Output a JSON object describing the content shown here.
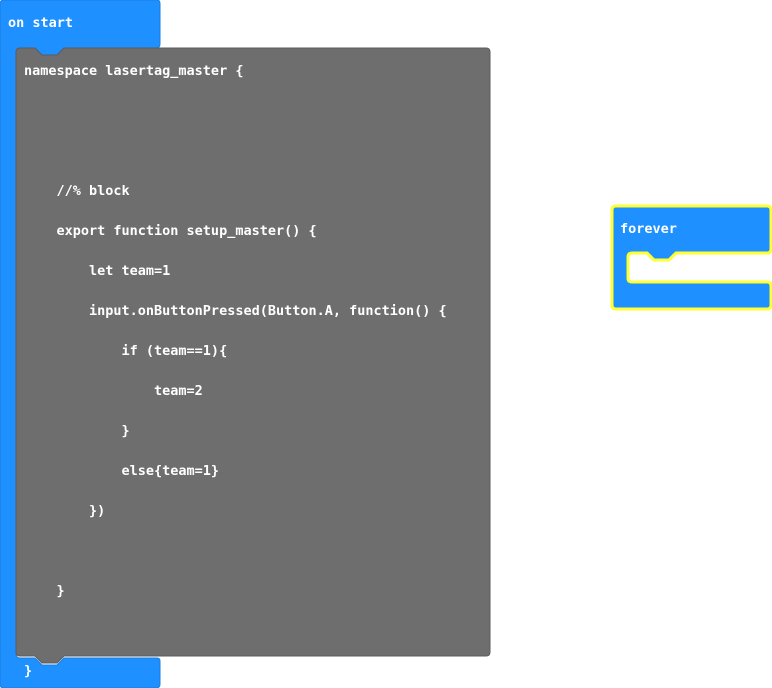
{
  "colors": {
    "event_block": "#1e90ff",
    "event_block_edge": "#1a7fdf",
    "code_block": "#6e6e6e",
    "code_block_edge": "#5c5c5c",
    "highlight": "#ffff33",
    "text": "#ffffff",
    "workspace": "#ffffff"
  },
  "on_start_block": {
    "label": "on start",
    "code_lines": [
      "namespace lasertag_master {",
      "",
      "",
      "    //% block",
      "    export function setup_master() {",
      "        let team=1",
      "        input.onButtonPressed(Button.A, function() {",
      "            if (team==1){",
      "                team=2",
      "            }",
      "            else{team=1}",
      "        })",
      "",
      "    }",
      "",
      "}"
    ]
  },
  "forever_block": {
    "label": "forever",
    "selected": true
  }
}
